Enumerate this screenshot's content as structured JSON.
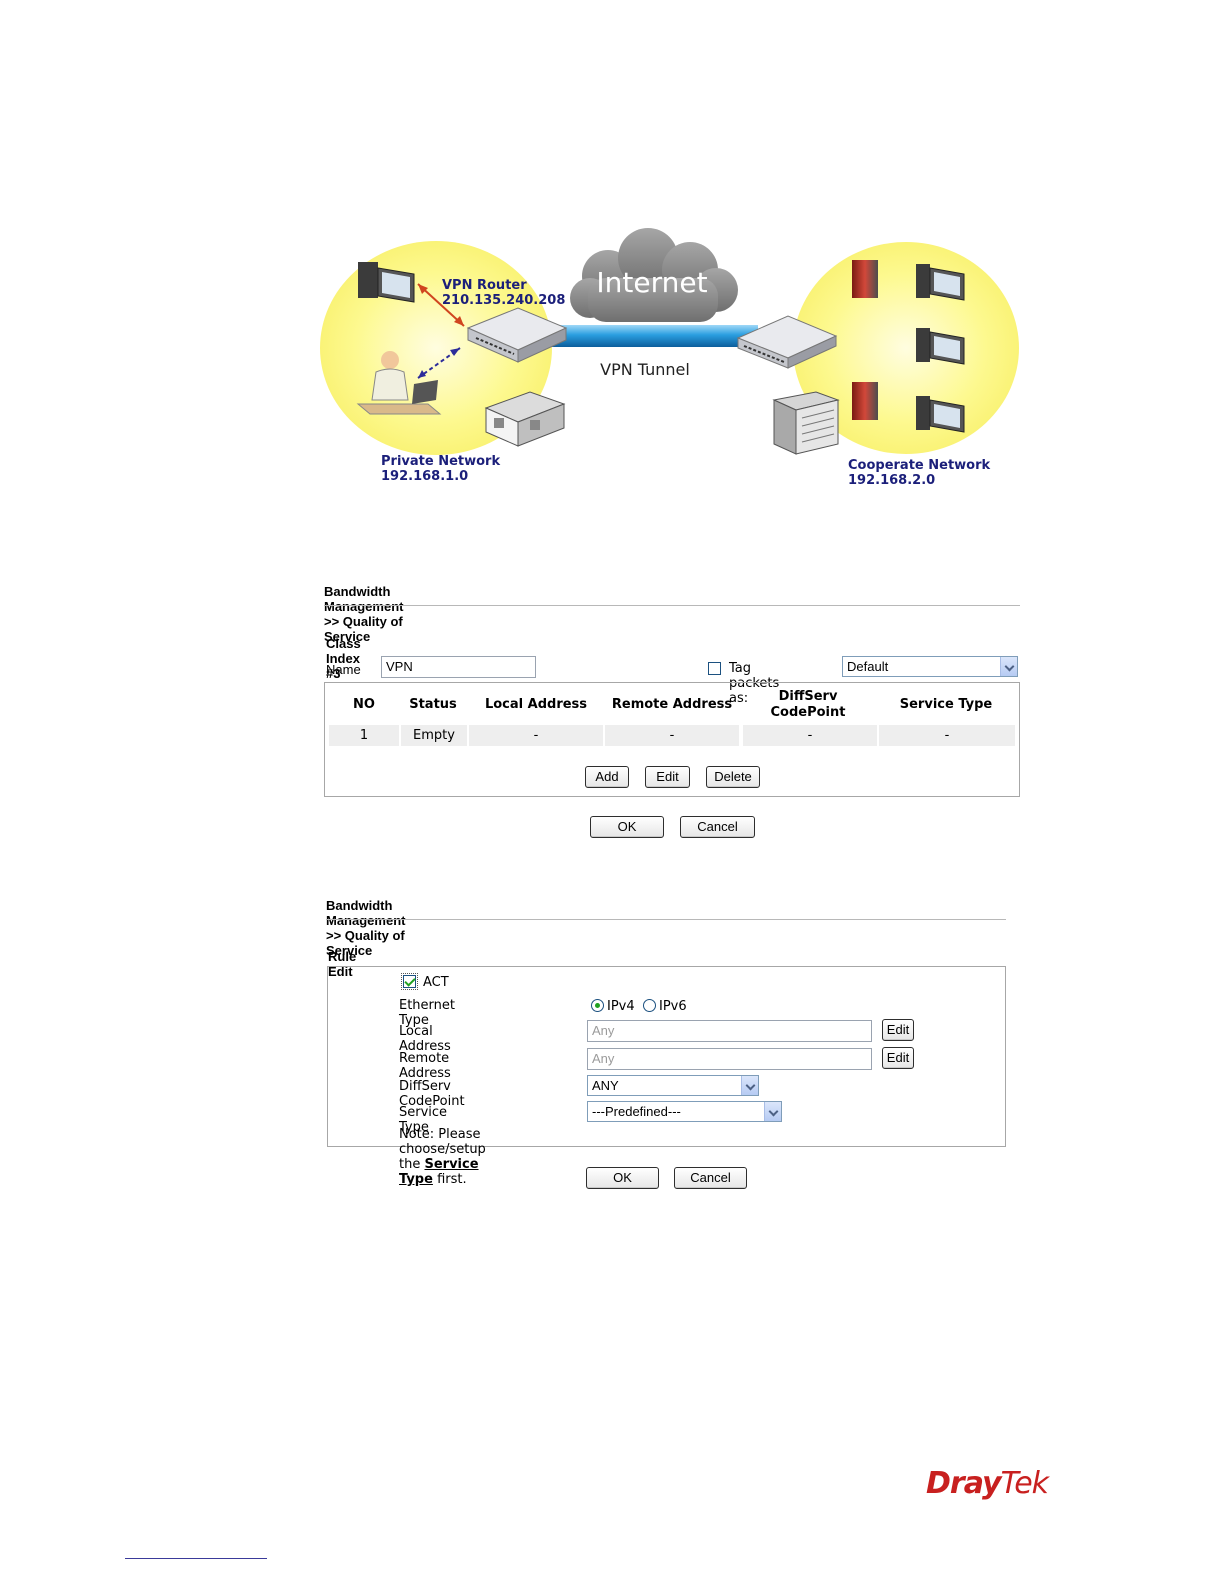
{
  "diagram": {
    "internet": "Internet",
    "vpn_tunnel": "VPN Tunnel",
    "vpn_router_label": "VPN Router",
    "vpn_router_ip": "210.135.240.208",
    "private_network_label": "Private Network",
    "private_network_ip": "192.168.1.0",
    "cooperate_network_label": "Cooperate Network",
    "cooperate_network_ip": "192.168.2.0"
  },
  "panel1": {
    "breadcrumb": "Bandwidth Management >> Quality of Service",
    "class_index": "Class Index #3",
    "name_label": "Name",
    "name_value": "VPN",
    "tag_label": "Tag packets as:",
    "tag_checked": false,
    "tag_value": "Default",
    "columns": {
      "no": "NO",
      "status": "Status",
      "local": "Local Address",
      "remote": "Remote Address",
      "diffserv_1": "DiffServ",
      "diffserv_2": "CodePoint",
      "service": "Service Type"
    },
    "row": {
      "no": "1",
      "status": "Empty",
      "local": "-",
      "remote": "-",
      "diffserv": "-",
      "service": "-"
    },
    "add_label": "Add",
    "edit_label": "Edit",
    "delete_label": "Delete",
    "ok_label": "OK",
    "cancel_label": "Cancel"
  },
  "panel2": {
    "breadcrumb": "Bandwidth Management >> Quality of Service",
    "title": "Rule Edit",
    "act_label": "ACT",
    "act_checked": true,
    "ethernet_type_label": "Ethernet Type",
    "ipv4_label": "IPv4",
    "ipv6_label": "IPv6",
    "ethernet_selected": "IPv4",
    "local_address_label": "Local Address",
    "local_address_value": "Any",
    "remote_address_label": "Remote Address",
    "remote_address_value": "Any",
    "diffserv_label": "DiffServ CodePoint",
    "diffserv_value": "ANY",
    "service_type_label": "Service Type",
    "service_type_value": "---Predefined---",
    "edit_label": "Edit",
    "note_prefix": "Note:",
    "note_text": "Please choose/setup the",
    "note_link": "Service Type",
    "note_suffix": "first.",
    "ok_label": "OK",
    "cancel_label": "Cancel"
  },
  "logo": {
    "part1": "Dray",
    "part2": "Tek"
  },
  "colors": {
    "network_yellow": "#fdfaa0",
    "tunnel_blue": "#2a9ee0",
    "label_navy": "#1b1f7a",
    "brand_red": "#c8201f"
  }
}
